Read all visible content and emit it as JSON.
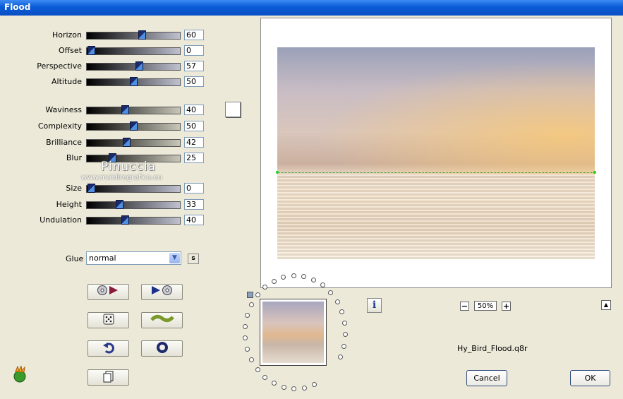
{
  "window": {
    "title": "Flood"
  },
  "sliders": [
    {
      "label": "Horizon",
      "value": "60",
      "level": 60
    },
    {
      "label": "Offset",
      "value": "0",
      "level": 0
    },
    {
      "label": "Perspective",
      "value": "57",
      "level": 57
    },
    {
      "label": "Altitude",
      "value": "50",
      "level": 50
    },
    {
      "label": "Waviness",
      "value": "40",
      "level": 40
    },
    {
      "label": "Complexity",
      "value": "50",
      "level": 50
    },
    {
      "label": "Brilliance",
      "value": "42",
      "level": 42
    },
    {
      "label": "Blur",
      "value": "25",
      "level": 25
    },
    {
      "label": "Size",
      "value": "0",
      "level": 0
    },
    {
      "label": "Height",
      "value": "33",
      "level": 33
    },
    {
      "label": "Undulation",
      "value": "40",
      "level": 40
    }
  ],
  "watermark": {
    "name": "Pinuccia",
    "site": "www.maidiregrafica.eu"
  },
  "glue": {
    "label": "Glue",
    "value": "normal",
    "s_label": "s"
  },
  "tool_buttons": [
    {
      "name": "load-preset-button",
      "icon": "disk-arrow-icon"
    },
    {
      "name": "save-preset-button",
      "icon": "arrow-disk-icon"
    },
    {
      "name": "randomize-button",
      "icon": "dice-icon"
    },
    {
      "name": "wave-button",
      "icon": "wave-icon"
    },
    {
      "name": "undo-button",
      "icon": "undo-icon"
    },
    {
      "name": "reset-button",
      "icon": "ring-icon"
    },
    {
      "name": "copy-button",
      "icon": "page-icon"
    }
  ],
  "zoom": {
    "minus": "−",
    "value": "50%",
    "plus": "+"
  },
  "info_label": "i",
  "filename": "Hy_Bird_Flood.q8r",
  "buttons": {
    "cancel": "Cancel",
    "ok": "OK"
  }
}
